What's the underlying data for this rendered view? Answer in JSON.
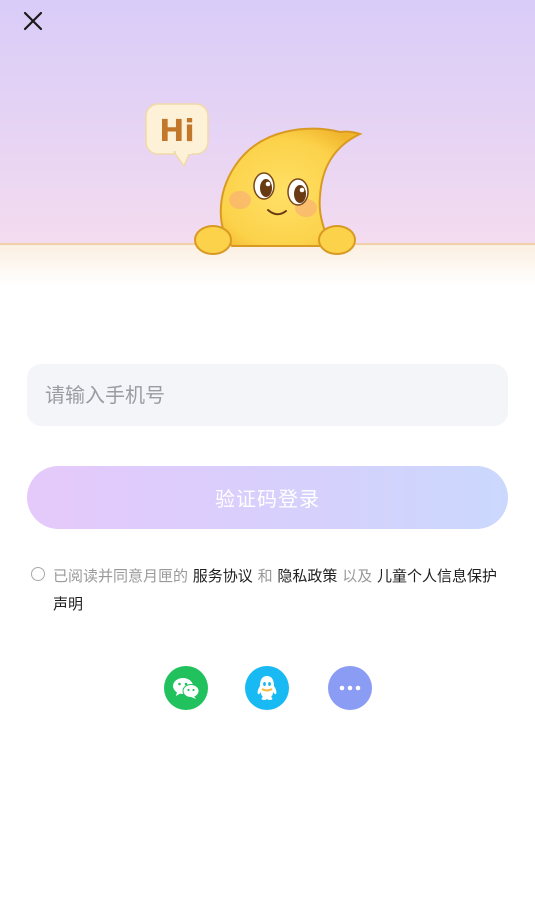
{
  "header": {
    "close_icon": "close-icon",
    "mascot": {
      "icon": "moon-mascot-illustration",
      "speech_bubble_text": "Hi"
    }
  },
  "login": {
    "phone_placeholder": "请输入手机号",
    "phone_value": "",
    "submit_label": "验证码登录"
  },
  "agreement": {
    "checked": false,
    "prefix_text": "已阅读并同意月匣的",
    "terms_link": "服务协议",
    "connector_and": "和",
    "privacy_link": "隐私政策",
    "connector_also": "以及",
    "children_privacy_link": "儿童个人信息保护声明"
  },
  "social_login": [
    {
      "name": "WeChat",
      "icon": "wechat-icon",
      "color": "#21c25e"
    },
    {
      "name": "QQ",
      "icon": "qq-icon",
      "color": "#19b9f3"
    },
    {
      "name": "More",
      "icon": "more-icon",
      "color": "#8a9cf3"
    }
  ],
  "colors": {
    "hero_gradient_top": "#d9ccf8",
    "hero_gradient_bottom": "#f4dcef",
    "button_gradient_left": "#e5c9fb",
    "button_gradient_right": "#cbd8fd",
    "input_background": "#f4f5f8"
  }
}
